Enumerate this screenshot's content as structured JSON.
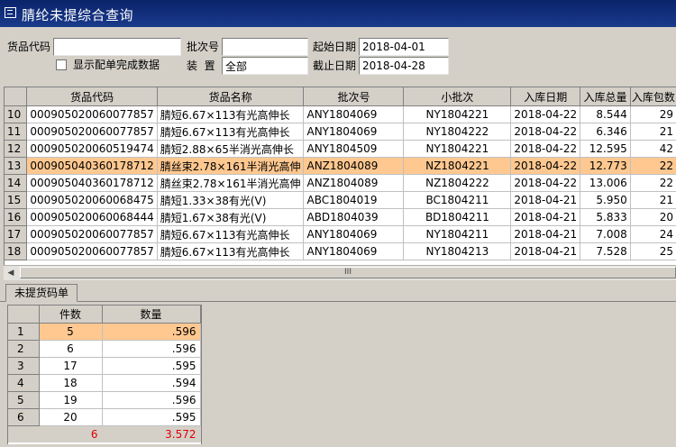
{
  "window": {
    "title": "腈纶未提综合查询"
  },
  "form": {
    "product_code_label": "货品代码",
    "product_code_value": "",
    "batch_label": "批次号",
    "batch_value": "",
    "start_date_label": "起始日期",
    "start_date_value": "2018-04-01",
    "show_completed_label": "显示配单完成数据",
    "show_completed_checked": false,
    "pack_label": "装  置",
    "pack_value": "全部",
    "end_date_label": "截止日期",
    "end_date_value": "2018-04-28"
  },
  "main_grid": {
    "columns": [
      "",
      "货品代码",
      "货品名称",
      "批次号",
      "小批次",
      "入库日期",
      "入库总量",
      "入库包数"
    ],
    "rows": [
      {
        "rn": "10",
        "code": "000905020060077857",
        "name": "腈短6.67×113有光高伸长",
        "batch": "ANY1804069",
        "sub": "NY1804221",
        "date": "2018-04-22",
        "qty": "8.544",
        "packs": "29"
      },
      {
        "rn": "11",
        "code": "000905020060077857",
        "name": "腈短6.67×113有光高伸长",
        "batch": "ANY1804069",
        "sub": "NY1804222",
        "date": "2018-04-22",
        "qty": "6.346",
        "packs": "21"
      },
      {
        "rn": "12",
        "code": "000905020060519474",
        "name": "腈短2.88×65半消光高伸长",
        "batch": "ANY1804509",
        "sub": "NY1804221",
        "date": "2018-04-22",
        "qty": "12.595",
        "packs": "42"
      },
      {
        "rn": "13",
        "code": "000905040360178712",
        "name": "腈丝束2.78×161半消光高伸",
        "batch": "ANZ1804089",
        "sub": "NZ1804221",
        "date": "2018-04-22",
        "qty": "12.773",
        "packs": "22"
      },
      {
        "rn": "14",
        "code": "000905040360178712",
        "name": "腈丝束2.78×161半消光高伸",
        "batch": "ANZ1804089",
        "sub": "NZ1804222",
        "date": "2018-04-22",
        "qty": "13.006",
        "packs": "22"
      },
      {
        "rn": "15",
        "code": "000905020060068475",
        "name": "腈短1.33×38有光(V)",
        "batch": "ABC1804019",
        "sub": "BC1804211",
        "date": "2018-04-21",
        "qty": "5.950",
        "packs": "21"
      },
      {
        "rn": "16",
        "code": "000905020060068444",
        "name": "腈短1.67×38有光(V)",
        "batch": "ABD1804039",
        "sub": "BD1804211",
        "date": "2018-04-21",
        "qty": "5.833",
        "packs": "20"
      },
      {
        "rn": "17",
        "code": "000905020060077857",
        "name": "腈短6.67×113有光高伸长",
        "batch": "ANY1804069",
        "sub": "NY1804211",
        "date": "2018-04-21",
        "qty": "7.008",
        "packs": "24"
      },
      {
        "rn": "18",
        "code": "000905020060077857",
        "name": "腈短6.67×113有光高伸长",
        "batch": "ANY1804069",
        "sub": "NY1804213",
        "date": "2018-04-21",
        "qty": "7.528",
        "packs": "25"
      }
    ],
    "selected_row": "13",
    "scrollbar_glyph": "III"
  },
  "tab": {
    "label": "未提货码单"
  },
  "detail_grid": {
    "columns": [
      "",
      "件数",
      "数量"
    ],
    "rows": [
      {
        "rn": "1",
        "count": "5",
        "qty": ".596"
      },
      {
        "rn": "2",
        "count": "6",
        "qty": ".596"
      },
      {
        "rn": "3",
        "count": "17",
        "qty": ".595"
      },
      {
        "rn": "4",
        "count": "18",
        "qty": ".594"
      },
      {
        "rn": "5",
        "count": "19",
        "qty": ".596"
      },
      {
        "rn": "6",
        "count": "20",
        "qty": ".595"
      }
    ],
    "selected_row": "1",
    "total_count": "6",
    "total_qty": "3.572"
  },
  "colors": {
    "selection": "#ffc890",
    "title_bar": "#0a246a",
    "total_text": "#e00000"
  }
}
